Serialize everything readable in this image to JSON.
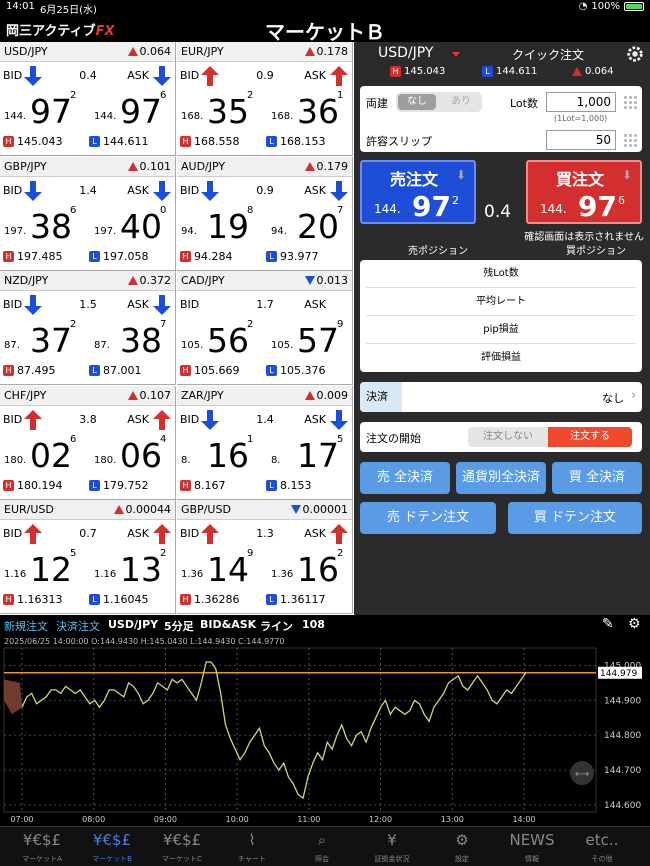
{
  "status": {
    "time": "14:01",
    "date": "6月25日(水)",
    "battery": "100%"
  },
  "header": {
    "logo_main": "岡三アクティブ",
    "logo_fx": "FX",
    "title": "マーケットＢ"
  },
  "tiles": [
    {
      "pair": "USD/JPY",
      "dir": "up",
      "change": "0.064",
      "bid_dir": "down",
      "ask_dir": "down",
      "spread": "0.4",
      "bid": {
        "pre": "144.",
        "big": "97",
        "sm": "2"
      },
      "ask": {
        "pre": "144.",
        "big": "97",
        "sm": "6"
      },
      "high": "145.043",
      "low": "144.611"
    },
    {
      "pair": "EUR/JPY",
      "dir": "up",
      "change": "0.178",
      "bid_dir": "up",
      "ask_dir": "up",
      "spread": "0.9",
      "bid": {
        "pre": "168.",
        "big": "35",
        "sm": "2"
      },
      "ask": {
        "pre": "168.",
        "big": "36",
        "sm": "1"
      },
      "high": "168.558",
      "low": "168.153"
    },
    {
      "pair": "GBP/JPY",
      "dir": "up",
      "change": "0.101",
      "bid_dir": "down",
      "ask_dir": "down",
      "spread": "1.4",
      "bid": {
        "pre": "197.",
        "big": "38",
        "sm": "6"
      },
      "ask": {
        "pre": "197.",
        "big": "40",
        "sm": "0"
      },
      "high": "197.485",
      "low": "197.058"
    },
    {
      "pair": "AUD/JPY",
      "dir": "up",
      "change": "0.179",
      "bid_dir": "down",
      "ask_dir": "down",
      "spread": "0.9",
      "bid": {
        "pre": "94.",
        "big": "19",
        "sm": "8"
      },
      "ask": {
        "pre": "94.",
        "big": "20",
        "sm": "7"
      },
      "high": "94.284",
      "low": "93.977"
    },
    {
      "pair": "NZD/JPY",
      "dir": "up",
      "change": "0.372",
      "bid_dir": "down",
      "ask_dir": "down",
      "spread": "1.5",
      "bid": {
        "pre": "87.",
        "big": "37",
        "sm": "2"
      },
      "ask": {
        "pre": "87.",
        "big": "38",
        "sm": "7"
      },
      "high": "87.495",
      "low": "87.001"
    },
    {
      "pair": "CAD/JPY",
      "dir": "down",
      "change": "0.013",
      "bid_dir": "",
      "ask_dir": "",
      "spread": "1.7",
      "bid": {
        "pre": "105.",
        "big": "56",
        "sm": "2"
      },
      "ask": {
        "pre": "105.",
        "big": "57",
        "sm": "9"
      },
      "high": "105.669",
      "low": "105.376"
    },
    {
      "pair": "CHF/JPY",
      "dir": "up",
      "change": "0.107",
      "bid_dir": "up",
      "ask_dir": "up",
      "spread": "3.8",
      "bid": {
        "pre": "180.",
        "big": "02",
        "sm": "6"
      },
      "ask": {
        "pre": "180.",
        "big": "06",
        "sm": "4"
      },
      "high": "180.194",
      "low": "179.752"
    },
    {
      "pair": "ZAR/JPY",
      "dir": "up",
      "change": "0.009",
      "bid_dir": "down",
      "ask_dir": "down",
      "spread": "1.4",
      "bid": {
        "pre": "8.",
        "big": "16",
        "sm": "1"
      },
      "ask": {
        "pre": "8.",
        "big": "17",
        "sm": "5"
      },
      "high": "8.167",
      "low": "8.153"
    },
    {
      "pair": "EUR/USD",
      "dir": "up",
      "change": "0.00044",
      "bid_dir": "up",
      "ask_dir": "up",
      "spread": "0.7",
      "bid": {
        "pre": "1.16",
        "big": "12",
        "sm": "5"
      },
      "ask": {
        "pre": "1.16",
        "big": "13",
        "sm": "2"
      },
      "high": "1.16313",
      "low": "1.16045"
    },
    {
      "pair": "GBP/USD",
      "dir": "down",
      "change": "0.00001",
      "bid_dir": "up",
      "ask_dir": "up",
      "spread": "1.3",
      "bid": {
        "pre": "1.36",
        "big": "14",
        "sm": "9"
      },
      "ask": {
        "pre": "1.36",
        "big": "16",
        "sm": "2"
      },
      "high": "1.36286",
      "low": "1.36117"
    }
  ],
  "tile_labels": {
    "bid": "BID",
    "ask": "ASK",
    "high_badge": "H",
    "low_badge": "L"
  },
  "order": {
    "symbol": "USD/JPY",
    "quick": "クイック注文",
    "high": "145.043",
    "low": "144.611",
    "change": "0.064",
    "ryodate": "両建",
    "nashi": "なし",
    "ari": "あり",
    "lot_label": "Lot数",
    "lot": "1,000",
    "lot_note": "(1Lot=1,000)",
    "slip_label": "許容スリップ",
    "slip": "50",
    "sell": {
      "label": "売注文",
      "pre": "144.",
      "big": "97",
      "sm": "2"
    },
    "buy": {
      "label": "買注文",
      "pre": "144.",
      "big": "97",
      "sm": "6"
    },
    "spread": "0.4",
    "confirm": "確認画面は表示されません",
    "sell_pos": "売ポジション",
    "buy_pos": "買ポジション",
    "rows": [
      "残Lot数",
      "平均レート",
      "pip損益",
      "評価損益"
    ],
    "kessai_label": "決済",
    "kessai_value": "なし",
    "start_label": "注文の開始",
    "start_off": "注文しない",
    "start_on": "注文する",
    "btn_sell_all": "売 全決済",
    "btn_currency_all": "通貨別全決済",
    "btn_buy_all": "買 全決済",
    "btn_sell_doten": "売 ドテン注文",
    "btn_buy_doten": "買 ドテン注文"
  },
  "chartbar": {
    "new": "新規注文",
    "close": "決済注文",
    "symbol": "USD/JPY",
    "interval": "5分足",
    "price_type": "BID&ASK",
    "draw": "ライン",
    "count": "108"
  },
  "chart_info": "2025/06/25 14:00:00  O:144.9430 H:145.0430 L:144.9430 C:144.9770",
  "chart_data": {
    "type": "line",
    "x_ticks": [
      "07:00",
      "08:00",
      "09:00",
      "10:00",
      "11:00",
      "12:00",
      "13:00",
      "14:00"
    ],
    "y_ticks": [
      "145.000",
      "144.900",
      "144.800",
      "144.700",
      "144.600"
    ],
    "ylim": [
      144.58,
      145.05
    ],
    "current": "144.979",
    "current_value": 144.979,
    "series": [
      {
        "values": [
          144.88,
          144.91,
          144.92,
          144.89,
          144.9,
          144.91,
          144.93,
          144.93,
          144.92,
          144.94,
          144.93,
          144.92,
          144.93,
          144.91,
          144.89,
          144.9,
          144.88,
          144.9,
          144.93,
          144.93,
          144.92,
          144.91,
          144.95,
          144.94,
          144.92,
          144.89,
          144.9,
          144.92,
          144.95,
          144.94,
          144.93,
          144.96,
          144.95,
          144.96,
          144.94,
          144.92,
          144.9,
          144.95,
          145.01,
          145.01,
          144.99,
          144.92,
          144.83,
          144.79,
          144.76,
          144.73,
          144.75,
          144.78,
          144.8,
          144.82,
          144.77,
          144.75,
          144.72,
          144.7,
          144.72,
          144.68,
          144.66,
          144.63,
          144.62,
          144.68,
          144.72,
          144.75,
          144.73,
          144.78,
          144.76,
          144.8,
          144.83,
          144.79,
          144.77,
          144.8,
          144.81,
          144.78,
          144.82,
          144.85,
          144.88,
          144.9,
          144.86,
          144.88,
          144.87,
          144.86,
          144.87,
          144.9,
          144.89,
          144.86,
          144.84,
          144.88,
          144.9,
          144.92,
          144.95,
          144.96,
          144.97,
          144.94,
          144.93,
          144.95,
          144.97,
          144.95,
          144.93,
          144.9,
          144.89,
          144.91,
          144.93,
          144.92,
          144.94,
          144.96,
          144.98
        ]
      }
    ],
    "colors": {
      "line": "#c9d97a",
      "current": "#e8962a",
      "bg": "#000000"
    }
  },
  "tabs": [
    {
      "label": "マーケットA",
      "icon": "¥€$£"
    },
    {
      "label": "マーケットB",
      "icon": "¥€$£",
      "active": true
    },
    {
      "label": "マーケットC",
      "icon": "¥€$£"
    },
    {
      "label": "チャート",
      "icon": "⌇"
    },
    {
      "label": "照会",
      "icon": "⌕"
    },
    {
      "label": "証拠金状況",
      "icon": "¥"
    },
    {
      "label": "設定",
      "icon": "⚙"
    },
    {
      "label": "情報",
      "icon": "NEWS"
    },
    {
      "label": "その他",
      "icon": "etc.."
    }
  ]
}
